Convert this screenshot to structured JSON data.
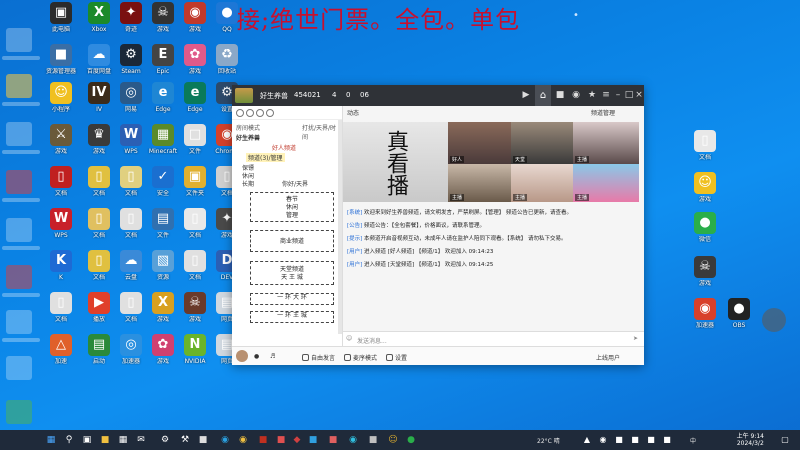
{
  "banner": {
    "text": "接;绝世门票。全包。单包",
    "dot": "•"
  },
  "desktop_icons": [
    {
      "label": "此电脑",
      "glyph": "▣",
      "color": "#2b2b2b"
    },
    {
      "label": "Xbox",
      "glyph": "X",
      "color": "#1c8a2a"
    },
    {
      "label": "奇迹",
      "glyph": "✦",
      "color": "#7a1010"
    },
    {
      "label": "游戏",
      "glyph": "☠",
      "color": "#333333"
    },
    {
      "label": "游戏",
      "glyph": "◉",
      "color": "#c0392b"
    },
    {
      "label": "QQ",
      "glyph": "●",
      "color": "#1d77d6"
    },
    {
      "label": "资源管理器",
      "glyph": "■",
      "color": "#3a6ea5"
    },
    {
      "label": "百度网盘",
      "glyph": "☁",
      "color": "#2f8be0"
    },
    {
      "label": "Steam",
      "glyph": "⚙",
      "color": "#1b2838"
    },
    {
      "label": "Epic",
      "glyph": "E",
      "color": "#444444"
    },
    {
      "label": "游戏",
      "glyph": "✿",
      "color": "#e05a8a"
    },
    {
      "label": "回收站",
      "glyph": "♻",
      "color": "#8aa8c8"
    },
    {
      "label": "小程序",
      "glyph": "☺",
      "color": "#f0c020"
    },
    {
      "label": "IV",
      "glyph": "IV",
      "color": "#3b2b1b"
    },
    {
      "label": "网易",
      "glyph": "◎",
      "color": "#2a5a8a"
    },
    {
      "label": "Edge",
      "glyph": "e",
      "color": "#1e86d4"
    },
    {
      "label": "Edge",
      "glyph": "e",
      "color": "#0a7a5a"
    },
    {
      "label": "设置",
      "glyph": "⚙",
      "color": "#2d4a6a"
    },
    {
      "label": "游戏",
      "glyph": "⚔",
      "color": "#6a5a3a"
    },
    {
      "label": "游戏",
      "glyph": "♛",
      "color": "#3a3a3a"
    },
    {
      "label": "WPS",
      "glyph": "W",
      "color": "#2b5fb4"
    },
    {
      "label": "Minecraft",
      "glyph": "▦",
      "color": "#5a8a2a"
    },
    {
      "label": "文件",
      "glyph": "□",
      "color": "#e0e0e0"
    },
    {
      "label": "Chrome",
      "glyph": "◉",
      "color": "#d4412b"
    },
    {
      "label": "文档",
      "glyph": "▯",
      "color": "#c02020"
    },
    {
      "label": "文档",
      "glyph": "▯",
      "color": "#e0c040"
    },
    {
      "label": "文档",
      "glyph": "▯",
      "color": "#e0d080"
    },
    {
      "label": "安全",
      "glyph": "✓",
      "color": "#1a6fd0"
    },
    {
      "label": "文件夹",
      "glyph": "▣",
      "color": "#e0b030"
    },
    {
      "label": "文档",
      "glyph": "▯",
      "color": "#d0d0d0"
    },
    {
      "label": "WPS",
      "glyph": "W",
      "color": "#c8202a"
    },
    {
      "label": "文档",
      "glyph": "▯",
      "color": "#e0c060"
    },
    {
      "label": "文档",
      "glyph": "▯",
      "color": "#e0e0e0"
    },
    {
      "label": "文件",
      "glyph": "▤",
      "color": "#3070b0"
    },
    {
      "label": "文档",
      "glyph": "▯",
      "color": "#e8e8e8"
    },
    {
      "label": "游戏",
      "glyph": "✦",
      "color": "#4a4a4a"
    },
    {
      "label": "K",
      "glyph": "K",
      "color": "#1e6ad4"
    },
    {
      "label": "文档",
      "glyph": "▯",
      "color": "#e0c040"
    },
    {
      "label": "云盘",
      "glyph": "☁",
      "color": "#3a8ad8"
    },
    {
      "label": "资源",
      "glyph": "▧",
      "color": "#58a0d8"
    },
    {
      "label": "文档",
      "glyph": "▯",
      "color": "#e0e0e0"
    },
    {
      "label": "DEV",
      "glyph": "D",
      "color": "#2b5fb4"
    },
    {
      "label": "文档",
      "glyph": "▯",
      "color": "#e0e0e0"
    },
    {
      "label": "播放",
      "glyph": "▶",
      "color": "#e0402a"
    },
    {
      "label": "文档",
      "glyph": "▯",
      "color": "#e0e0e0"
    },
    {
      "label": "游戏",
      "glyph": "X",
      "color": "#d8a020"
    },
    {
      "label": "游戏",
      "glyph": "☠",
      "color": "#6a3a2a"
    },
    {
      "label": "网页",
      "glyph": "▤",
      "color": "#d0d8e0"
    },
    {
      "label": "加速",
      "glyph": "△",
      "color": "#e0602a"
    },
    {
      "label": "启动",
      "glyph": "▤",
      "color": "#2a8a3a"
    },
    {
      "label": "加速器",
      "glyph": "◎",
      "color": "#2a90e0"
    },
    {
      "label": "游戏",
      "glyph": "✿",
      "color": "#d04070"
    },
    {
      "label": "NVIDIA",
      "glyph": "N",
      "color": "#6ab42a"
    },
    {
      "label": "网页",
      "glyph": "▤",
      "color": "#d0d8e0"
    }
  ],
  "app": {
    "title_items": [
      "好生养兽",
      "454021",
      "4",
      "0",
      "06"
    ],
    "left_tabs": [
      "房间模式",
      "打扰/天界/时间"
    ],
    "channel_header": "好生养兽",
    "channel_rows": [
      "好人频道",
      "频道(3)/管理",
      "保镖",
      "休闲",
      "长期",
      "你好/天界"
    ],
    "boxes": [
      {
        "lines": [
          "春节",
          "休闲",
          "管理"
        ]
      },
      {
        "lines": [
          "商业频道"
        ]
      },
      {
        "lines": [
          "天堂频道",
          "天 王 城"
        ]
      },
      {
        "lines": [
          "一 环 大 环"
        ]
      },
      {
        "lines": [
          "一 环 王 城"
        ]
      }
    ],
    "right_top_left": "动态",
    "right_top_right": "频道管理",
    "video_big_text": "真看播",
    "video_names": [
      "好人",
      "天堂",
      "主播",
      "主播",
      "主播",
      "主播"
    ],
    "messages": [
      {
        "tag": "[系统]",
        "text": "欢迎来到好生养兽频道，请文明发言，严禁刷屏。【管理】 频道公告已更新，请查看。"
      },
      {
        "tag": "[公告]",
        "text": "频道公告：【全包套餐】，价格面议，请联系管理。"
      },
      {
        "tag": "[提示]",
        "text": "本频道开启音视频互动，未成年人请在监护人陪同下观看。【系统】 请勿私下交易。"
      },
      {
        "tag": "[用户]",
        "text": "进入频道 [好人频道] 【频道/1】 欢迎加入 09:14:23"
      },
      {
        "tag": "[用户]",
        "text": "进入频道 [天堂频道] 【频道/1】 欢迎加入 09:14:25"
      }
    ],
    "input_placeholder": "发送消息...",
    "bottom_items": [
      "自由发言",
      "麦序模式",
      "设置",
      "上线用户"
    ]
  },
  "right_icons": [
    {
      "label": "文档",
      "glyph": "▯",
      "color": "#e8e8e8"
    },
    {
      "label": "游戏",
      "glyph": "☺",
      "color": "#f0c020"
    },
    {
      "label": "微信",
      "glyph": "●",
      "color": "#2aae4a"
    },
    {
      "label": "游戏",
      "glyph": "☠",
      "color": "#3a3a3a"
    },
    {
      "label": "加速器",
      "glyph": "◉",
      "color": "#d8402a"
    },
    {
      "label": "OBS",
      "glyph": "●",
      "color": "#222222"
    }
  ],
  "taskbar": {
    "weather": "22°C 晴",
    "clock_time": "上午 9:14",
    "clock_date": "2024/3/2",
    "lang": "中"
  }
}
